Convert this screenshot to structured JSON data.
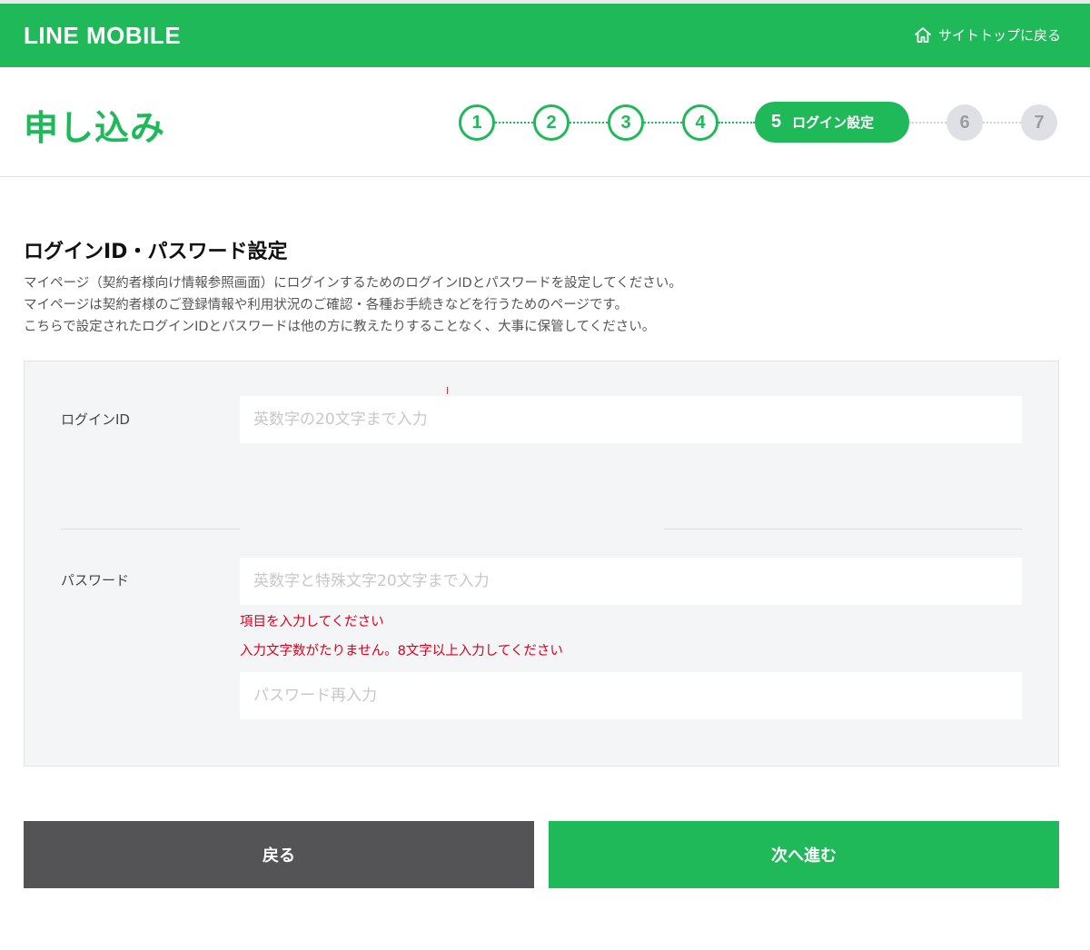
{
  "header": {
    "logo": "LINE MOBILE",
    "back_to_top": "サイトトップに戻る",
    "back_to_top_icon": "home-icon"
  },
  "page": {
    "title": "申し込み"
  },
  "steps": {
    "items": [
      "1",
      "2",
      "3",
      "4",
      "5",
      "6",
      "7"
    ],
    "current_label": "ログイン設定",
    "current_index": 5
  },
  "section": {
    "title": "ログインID・パスワード設定",
    "lines": [
      "マイページ（契約者様向け情報参照画面）にログインするためのログインIDとパスワードを設定してください。",
      "マイページは契約者様のご登録情報や利用状況のご確認・各種お手続きなどを行うためのページです。",
      "こちらで設定されたログインIDとパスワードは他の方に教えたりすることなく、大事に保管してください。"
    ]
  },
  "form": {
    "login_id_label": "ログインID",
    "login_id_placeholder": "英数字の20文字まで入力",
    "login_id_value": "",
    "password_label": "パスワード",
    "password_placeholder": "英数字と特殊文字20文字まで入力",
    "password_value": "",
    "password_errors": [
      "項目を入力してください",
      "入力文字数がたりません。8文字以上入力してください"
    ],
    "password_confirm_placeholder": "パスワード再入力",
    "password_confirm_value": ""
  },
  "buttons": {
    "back": "戻る",
    "next": "次へ進む"
  },
  "colors": {
    "brand_green": "#20b95a",
    "error_red": "#d9001b",
    "back_button": "#545456",
    "step_inactive": "#dfe0e4"
  }
}
